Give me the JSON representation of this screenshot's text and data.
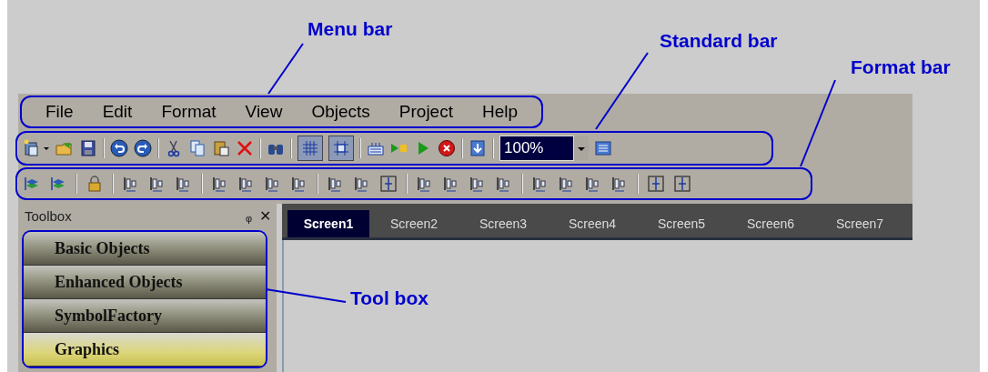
{
  "annotations": [
    {
      "label": "Menu bar"
    },
    {
      "label": "Standard bar"
    },
    {
      "label": "Format bar"
    },
    {
      "label": "Tool box"
    }
  ],
  "menu_bar": {
    "items": [
      "File",
      "Edit",
      "Format",
      "View",
      "Objects",
      "Project",
      "Help"
    ]
  },
  "standard_bar": {
    "grid_on": true,
    "snap_on": true,
    "zoom": "100%"
  },
  "toolbox": {
    "title": "Toolbox",
    "pin": "ᵩ",
    "close": "✕",
    "items": [
      {
        "label": "Basic Objects",
        "selected": false
      },
      {
        "label": "Enhanced Objects",
        "selected": false
      },
      {
        "label": "SymbolFactory",
        "selected": false
      },
      {
        "label": "Graphics",
        "selected": true
      }
    ]
  },
  "tabs": [
    {
      "label": "Screen1",
      "selected": true
    },
    {
      "label": "Screen2",
      "selected": false
    },
    {
      "label": "Screen3",
      "selected": false
    },
    {
      "label": "Screen4",
      "selected": false
    },
    {
      "label": "Screen5",
      "selected": false
    },
    {
      "label": "Screen6",
      "selected": false
    },
    {
      "label": "Screen7",
      "selected": false
    }
  ]
}
